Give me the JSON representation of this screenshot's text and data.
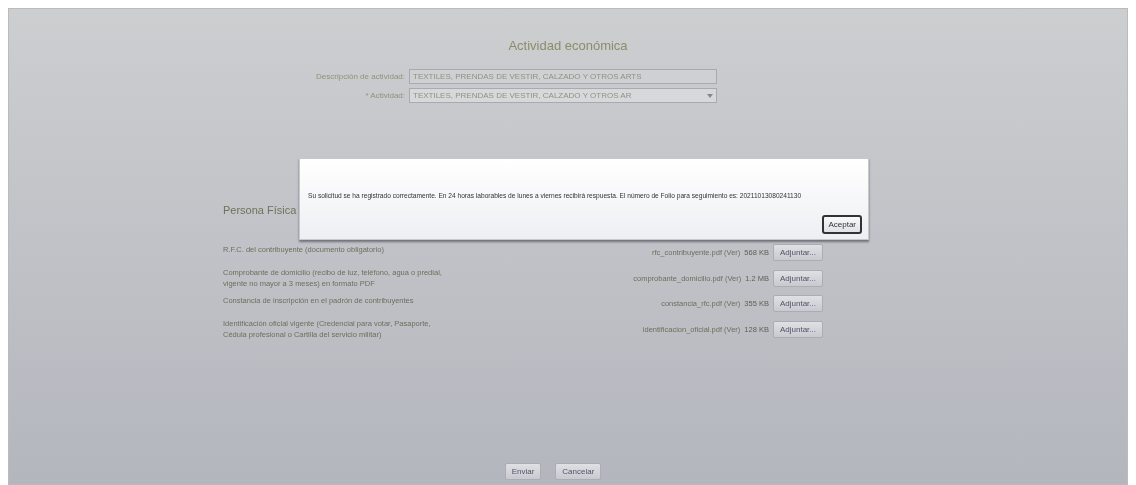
{
  "section_title": "Actividad económica",
  "fields": [
    {
      "kind": "text",
      "label": "Descripción de actividad:",
      "value": "TEXTILES, PRENDAS DE VESTIR, CALZADO Y OTROS ARTS"
    },
    {
      "kind": "select",
      "label": "* Actividad:",
      "value": "TEXTILES, PRENDAS DE VESTIR, CALZADO Y OTROS AR"
    }
  ],
  "documents_title": "Persona Física",
  "documents": [
    {
      "label": "R.F.C. del contribuyente (documento obligatorio)",
      "file": "rfc_contribuyente.pdf (Ver)",
      "size": "568 KB",
      "button": "Adjuntar..."
    },
    {
      "label": "Comprobante de domicilio (recibo de luz, teléfono, agua o predial, vigente no mayor a 3 meses) en formato PDF",
      "file": "comprobante_domicilio.pdf (Ver)",
      "size": "1.2 MB",
      "button": "Adjuntar..."
    },
    {
      "label": "Constancia de inscripción en el padrón de contribuyentes",
      "file": "constancia_rfc.pdf (Ver)",
      "size": "355 KB",
      "button": "Adjuntar..."
    },
    {
      "label": "Identificación oficial vigente (Credencial para votar, Pasaporte, Cédula profesional o Cartilla del servicio militar)",
      "file": "identificacion_oficial.pdf (Ver)",
      "size": "128 KB",
      "button": "Adjuntar..."
    }
  ],
  "footer_buttons": [
    "Enviar",
    "Cancelar"
  ],
  "dialog": {
    "message": "Su solicitud se ha registrado correctamente. En 24 horas laborables de lunes a viernes recibirá respuesta. El número de Folio para seguimiento es: 20211013080241130",
    "button": "Aceptar"
  }
}
